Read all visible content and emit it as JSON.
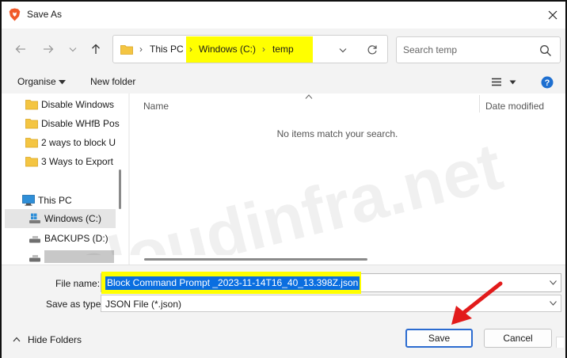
{
  "window": {
    "title": "Save As",
    "close_label": "✕"
  },
  "nav": {
    "back_icon": "back-arrow-icon",
    "forward_icon": "forward-arrow-icon",
    "recent_icon": "chevron-down-icon",
    "up_icon": "up-arrow-icon"
  },
  "address": {
    "separator": "›",
    "crumbs": [
      "This PC",
      "Windows (C:)",
      "temp"
    ]
  },
  "search": {
    "placeholder": "Search temp"
  },
  "toolbar": {
    "organise_label": "Organise",
    "new_folder_label": "New folder"
  },
  "sidebar": {
    "items": [
      {
        "label": "Disable Windows",
        "icon": "folder-icon"
      },
      {
        "label": "Disable WHfB Pos",
        "icon": "folder-icon"
      },
      {
        "label": "2 ways to block U",
        "icon": "folder-icon"
      },
      {
        "label": "3 Ways to Export",
        "icon": "folder-icon"
      },
      {
        "label": "This PC",
        "icon": "computer-icon"
      },
      {
        "label": "Windows (C:)",
        "icon": "drive-icon",
        "selected": true
      },
      {
        "label": "BACKUPS (D:)",
        "icon": "drive-icon"
      },
      {
        "label": "",
        "icon": "drive-icon"
      }
    ]
  },
  "filelist": {
    "columns": [
      "Name",
      "Date modified"
    ],
    "empty_message": "No items match your search."
  },
  "form": {
    "file_name_label": "File name:",
    "file_name_value": "Block Command Prompt _2023-11-14T16_40_13.398Z.json",
    "save_as_type_label": "Save as type:",
    "save_as_type_value": "JSON File (*.json)"
  },
  "footer": {
    "hide_folders_label": "Hide Folders",
    "save_label": "Save",
    "cancel_label": "Cancel"
  },
  "annotation": {
    "watermark_text": "cloudinfra.net",
    "highlight_color": "#ffff00",
    "arrow_color": "#e21b1b"
  }
}
